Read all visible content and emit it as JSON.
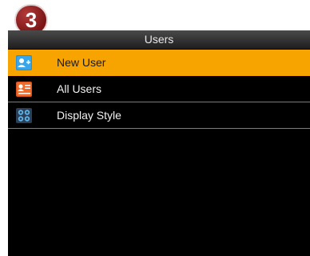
{
  "badge": {
    "number": "3"
  },
  "header": {
    "title": "Users"
  },
  "menu": {
    "items": [
      {
        "label": "New User",
        "icon": "new-user-icon",
        "selected": true
      },
      {
        "label": "All Users",
        "icon": "all-users-icon",
        "selected": false
      },
      {
        "label": "Display Style",
        "icon": "display-style-icon",
        "selected": false
      }
    ]
  },
  "colors": {
    "selected": "#f7a300",
    "background": "#000000",
    "badge": "#7a1515"
  }
}
